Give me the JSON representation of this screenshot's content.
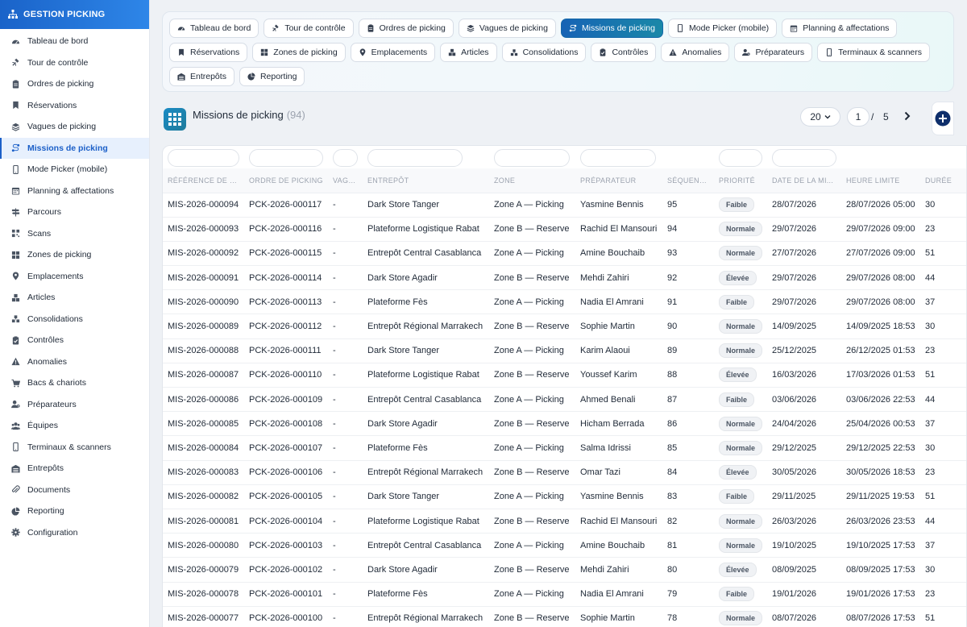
{
  "app": {
    "title": "GESTION PICKING"
  },
  "sidebar": {
    "items": [
      {
        "label": "Tableau de bord",
        "icon": "dashboard-icon"
      },
      {
        "label": "Tour de contrôle",
        "icon": "satellite-icon"
      },
      {
        "label": "Ordres de picking",
        "icon": "clipboard-icon"
      },
      {
        "label": "Réservations",
        "icon": "bookmark-icon"
      },
      {
        "label": "Vagues de picking",
        "icon": "layers-icon"
      },
      {
        "label": "Missions de picking",
        "icon": "route-icon",
        "active": true
      },
      {
        "label": "Mode Picker (mobile)",
        "icon": "mobile-icon"
      },
      {
        "label": "Planning & affectations",
        "icon": "calendar-icon"
      },
      {
        "label": "Parcours",
        "icon": "signpost-icon"
      },
      {
        "label": "Scans",
        "icon": "qrcode-icon"
      },
      {
        "label": "Zones de picking",
        "icon": "grid-icon"
      },
      {
        "label": "Emplacements",
        "icon": "map-pin-icon"
      },
      {
        "label": "Articles",
        "icon": "boxes-icon"
      },
      {
        "label": "Consolidations",
        "icon": "cubes-icon"
      },
      {
        "label": "Contrôles",
        "icon": "clipboard-check-icon"
      },
      {
        "label": "Anomalies",
        "icon": "warning-icon"
      },
      {
        "label": "Bacs & chariots",
        "icon": "cart-icon"
      },
      {
        "label": "Préparateurs",
        "icon": "user-gear-icon"
      },
      {
        "label": "Équipes",
        "icon": "users-icon"
      },
      {
        "label": "Terminaux & scanners",
        "icon": "mobile-icon"
      },
      {
        "label": "Entrepôts",
        "icon": "warehouse-icon"
      },
      {
        "label": "Documents",
        "icon": "paperclip-icon"
      },
      {
        "label": "Reporting",
        "icon": "pie-chart-icon"
      },
      {
        "label": "Configuration",
        "icon": "gear-icon"
      }
    ]
  },
  "tabs": [
    {
      "label": "Tableau de bord",
      "icon": "dashboard-icon"
    },
    {
      "label": "Tour de contrôle",
      "icon": "satellite-icon"
    },
    {
      "label": "Ordres de picking",
      "icon": "clipboard-icon"
    },
    {
      "label": "Vagues de picking",
      "icon": "layers-icon"
    },
    {
      "label": "Missions de picking",
      "icon": "route-icon",
      "active": true
    },
    {
      "label": "Mode Picker (mobile)",
      "icon": "mobile-icon"
    },
    {
      "label": "Planning & affectations",
      "icon": "calendar-icon"
    },
    {
      "label": "Réservations",
      "icon": "bookmark-icon"
    },
    {
      "label": "Zones de picking",
      "icon": "grid-icon"
    },
    {
      "label": "Emplacements",
      "icon": "map-pin-icon"
    },
    {
      "label": "Articles",
      "icon": "boxes-icon"
    },
    {
      "label": "Consolidations",
      "icon": "cubes-icon"
    },
    {
      "label": "Contrôles",
      "icon": "clipboard-check-icon"
    },
    {
      "label": "Anomalies",
      "icon": "warning-icon"
    },
    {
      "label": "Préparateurs",
      "icon": "user-gear-icon"
    },
    {
      "label": "Terminaux & scanners",
      "icon": "mobile-icon"
    },
    {
      "label": "Entrepôts",
      "icon": "warehouse-icon"
    },
    {
      "label": "Reporting",
      "icon": "pie-chart-icon"
    }
  ],
  "page": {
    "title": "Missions de picking",
    "count": "(94)",
    "per_page": "20",
    "current_page": "1",
    "separator": "/",
    "total_pages": "5"
  },
  "table": {
    "columns": [
      "RÉFÉRENCE DE L...",
      "ORDRE DE PICKING",
      "VAGUE",
      "ENTREPÔT",
      "ZONE",
      "PRÉPARATEUR",
      "SÉQUENCE",
      "PRIORITÉ",
      "DATE DE LA MI...",
      "HEURE LIMITE",
      "DURÉE"
    ],
    "rows": [
      [
        "MIS-2026-000094",
        "PCK-2026-000117",
        "-",
        "Dark Store Tanger",
        "Zone A — Picking",
        "Yasmine Bennis",
        "95",
        "Faible",
        "28/07/2026",
        "28/07/2026 05:00",
        "30"
      ],
      [
        "MIS-2026-000093",
        "PCK-2026-000116",
        "-",
        "Plateforme Logistique Rabat",
        "Zone B — Reserve",
        "Rachid El Mansouri",
        "94",
        "Normale",
        "29/07/2026",
        "29/07/2026 09:00",
        "23"
      ],
      [
        "MIS-2026-000092",
        "PCK-2026-000115",
        "-",
        "Entrepôt Central Casablanca",
        "Zone A — Picking",
        "Amine Bouchaib",
        "93",
        "Normale",
        "27/07/2026",
        "27/07/2026 09:00",
        "51"
      ],
      [
        "MIS-2026-000091",
        "PCK-2026-000114",
        "-",
        "Dark Store Agadir",
        "Zone B — Reserve",
        "Mehdi Zahiri",
        "92",
        "Élevée",
        "29/07/2026",
        "29/07/2026 08:00",
        "44"
      ],
      [
        "MIS-2026-000090",
        "PCK-2026-000113",
        "-",
        "Plateforme Fès",
        "Zone A — Picking",
        "Nadia El Amrani",
        "91",
        "Faible",
        "29/07/2026",
        "29/07/2026 08:00",
        "37"
      ],
      [
        "MIS-2026-000089",
        "PCK-2026-000112",
        "-",
        "Entrepôt Régional Marrakech",
        "Zone B — Reserve",
        "Sophie Martin",
        "90",
        "Normale",
        "14/09/2025",
        "14/09/2025 18:53",
        "30"
      ],
      [
        "MIS-2026-000088",
        "PCK-2026-000111",
        "-",
        "Dark Store Tanger",
        "Zone A — Picking",
        "Karim Alaoui",
        "89",
        "Normale",
        "25/12/2025",
        "26/12/2025 01:53",
        "23"
      ],
      [
        "MIS-2026-000087",
        "PCK-2026-000110",
        "-",
        "Plateforme Logistique Rabat",
        "Zone B — Reserve",
        "Youssef Karim",
        "88",
        "Élevée",
        "16/03/2026",
        "17/03/2026 01:53",
        "51"
      ],
      [
        "MIS-2026-000086",
        "PCK-2026-000109",
        "-",
        "Entrepôt Central Casablanca",
        "Zone A — Picking",
        "Ahmed Benali",
        "87",
        "Faible",
        "03/06/2026",
        "03/06/2026 22:53",
        "44"
      ],
      [
        "MIS-2026-000085",
        "PCK-2026-000108",
        "-",
        "Dark Store Agadir",
        "Zone B — Reserve",
        "Hicham Berrada",
        "86",
        "Normale",
        "24/04/2026",
        "25/04/2026 00:53",
        "37"
      ],
      [
        "MIS-2026-000084",
        "PCK-2026-000107",
        "-",
        "Plateforme Fès",
        "Zone A — Picking",
        "Salma Idrissi",
        "85",
        "Normale",
        "29/12/2025",
        "29/12/2025 22:53",
        "30"
      ],
      [
        "MIS-2026-000083",
        "PCK-2026-000106",
        "-",
        "Entrepôt Régional Marrakech",
        "Zone B — Reserve",
        "Omar Tazi",
        "84",
        "Élevée",
        "30/05/2026",
        "30/05/2026 18:53",
        "23"
      ],
      [
        "MIS-2026-000082",
        "PCK-2026-000105",
        "-",
        "Dark Store Tanger",
        "Zone A — Picking",
        "Yasmine Bennis",
        "83",
        "Faible",
        "29/11/2025",
        "29/11/2025 19:53",
        "51"
      ],
      [
        "MIS-2026-000081",
        "PCK-2026-000104",
        "-",
        "Plateforme Logistique Rabat",
        "Zone B — Reserve",
        "Rachid El Mansouri",
        "82",
        "Normale",
        "26/03/2026",
        "26/03/2026 23:53",
        "44"
      ],
      [
        "MIS-2026-000080",
        "PCK-2026-000103",
        "-",
        "Entrepôt Central Casablanca",
        "Zone A — Picking",
        "Amine Bouchaib",
        "81",
        "Normale",
        "19/10/2025",
        "19/10/2025 17:53",
        "37"
      ],
      [
        "MIS-2026-000079",
        "PCK-2026-000102",
        "-",
        "Dark Store Agadir",
        "Zone B — Reserve",
        "Mehdi Zahiri",
        "80",
        "Élevée",
        "08/09/2025",
        "08/09/2025 17:53",
        "30"
      ],
      [
        "MIS-2026-000078",
        "PCK-2026-000101",
        "-",
        "Plateforme Fès",
        "Zone A — Picking",
        "Nadia El Amrani",
        "79",
        "Faible",
        "19/01/2026",
        "19/01/2026 17:53",
        "23"
      ],
      [
        "MIS-2026-000077",
        "PCK-2026-000100",
        "-",
        "Entrepôt Régional Marrakech",
        "Zone B — Reserve",
        "Sophie Martin",
        "78",
        "Normale",
        "08/07/2026",
        "08/07/2026 17:53",
        "51"
      ]
    ]
  },
  "colors": {
    "brand": "#1a63c9",
    "link": "#1a6fc2",
    "active_tab": "#1763b5"
  }
}
